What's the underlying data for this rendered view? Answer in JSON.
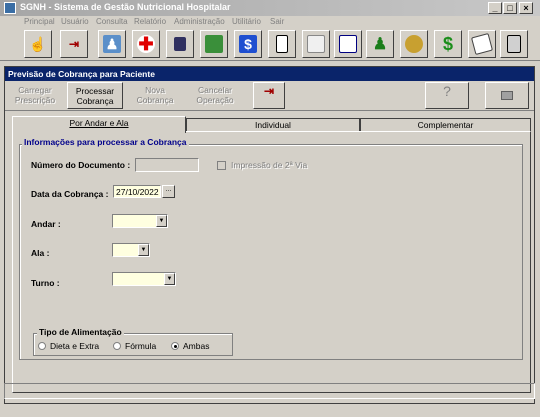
{
  "app": {
    "title": "SGNH - Sistema de Gestão Nutricional Hospitalar"
  },
  "menu": [
    "Principal",
    "Usuário",
    "Consulta",
    "Relatório",
    "Administração",
    "Utilitário",
    "Sair"
  ],
  "window": {
    "title": "Previsão de Cobrança para Paciente"
  },
  "actions": {
    "carregar": [
      "Carregar",
      "Prescrição"
    ],
    "processar": [
      "Processar",
      "Cobrança"
    ],
    "nova": [
      "Nova",
      "Cobrança"
    ],
    "cancelar": [
      "Cancelar",
      "Operação"
    ]
  },
  "tabs": [
    "Por Andar e Ala",
    "Individual",
    "Complementar"
  ],
  "form": {
    "group_title": "Informações para processar a Cobrança",
    "numero_label": "Número do Documento :",
    "numero_value": "",
    "reimpressao_label": "Impressão de 2ª Via",
    "data_label": "Data da Cobrança :",
    "data_value": "27/10/2022",
    "data_button": "...",
    "andar_label": "Andar :",
    "ala_label": "Ala :",
    "turno_label": "Turno :",
    "andar_value": "",
    "ala_value": "",
    "turno_value": ""
  },
  "alimentacao": {
    "title": "Tipo de Alimentação",
    "options": [
      "Dieta e Extra",
      "Fórmula",
      "Ambas"
    ],
    "selected": "Ambas"
  },
  "toolbar_icons": [
    "hand-icon",
    "exit-icon",
    "patient-icon",
    "red-cross-icon",
    "device-icon",
    "cash-register-icon",
    "dollar-icon",
    "document-icon",
    "report-icon",
    "list-icon",
    "user-icon",
    "coins-icon",
    "green-dollar-icon",
    "checklist-icon",
    "calculator-icon"
  ]
}
